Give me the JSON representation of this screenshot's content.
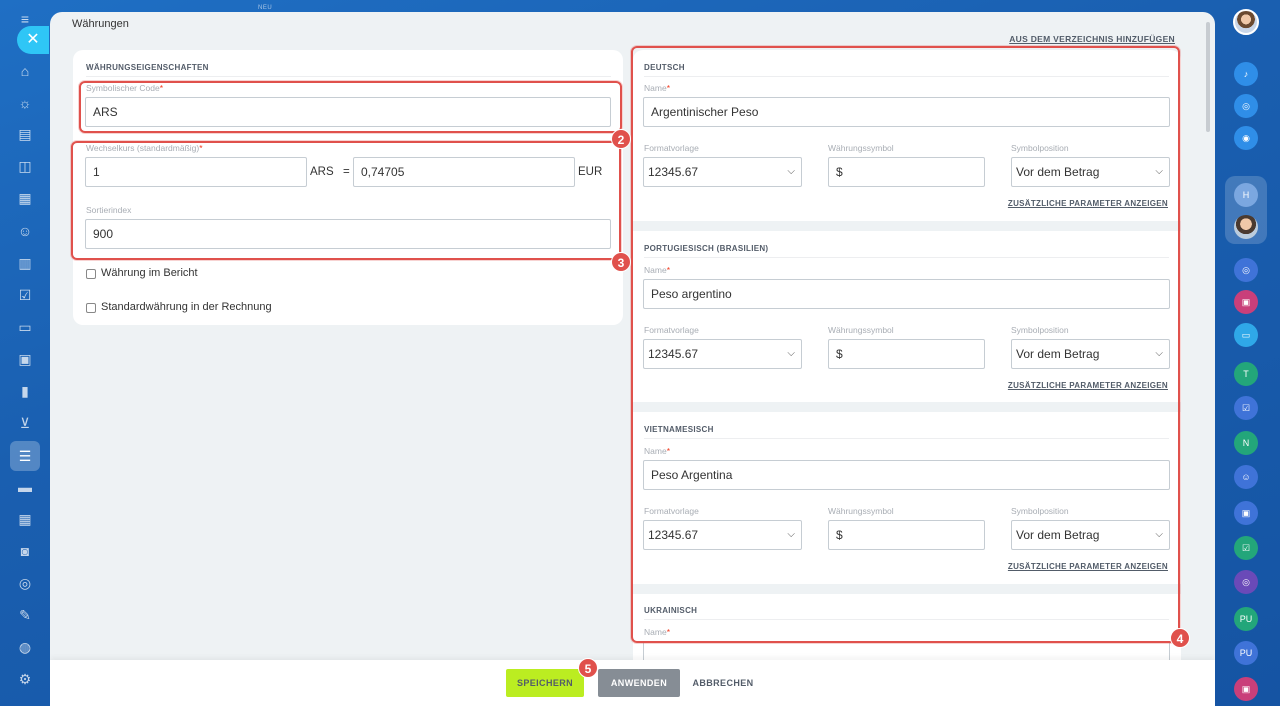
{
  "sidebar": {
    "new_tag": "NEU"
  },
  "page": {
    "title": "Währungen",
    "add_from_directory": "AUS DEM VERZEICHNIS HINZUFÜGEN"
  },
  "properties": {
    "section_title": "WÄHRUNGSEIGENSCHAFTEN",
    "symbolic_code_label": "Symbolischer Code",
    "symbolic_code_value": "ARS",
    "exchange_rate_label": "Wechselkurs (standardmäßig)",
    "rate_amount": "1",
    "rate_currency": "ARS",
    "equals": "=",
    "rate_value": "0,74705",
    "base_currency": "EUR",
    "sort_label": "Sortierindex",
    "sort_value": "900",
    "report_checkbox": "Währung im Bericht",
    "invoice_checkbox": "Standardwährung in der Rechnung"
  },
  "languages": [
    {
      "title": "DEUTSCH",
      "name_label": "Name",
      "name_value": "Argentinischer Peso",
      "format_label": "Formatvorlage",
      "format_value": "12345.67",
      "symbol_label": "Währungssymbol",
      "symbol_value": "$",
      "position_label": "Symbolposition",
      "position_value": "Vor dem Betrag",
      "more": "ZUSÄTZLICHE PARAMETER ANZEIGEN"
    },
    {
      "title": "PORTUGIESISCH (BRASILIEN)",
      "name_label": "Name",
      "name_value": "Peso argentino",
      "format_label": "Formatvorlage",
      "format_value": "12345.67",
      "symbol_label": "Währungssymbol",
      "symbol_value": "$",
      "position_label": "Symbolposition",
      "position_value": "Vor dem Betrag",
      "more": "ZUSÄTZLICHE PARAMETER ANZEIGEN"
    },
    {
      "title": "VIETNAMESISCH",
      "name_label": "Name",
      "name_value": "Peso Argentina",
      "format_label": "Formatvorlage",
      "format_value": "12345.67",
      "symbol_label": "Währungssymbol",
      "symbol_value": "$",
      "position_label": "Symbolposition",
      "position_value": "Vor dem Betrag",
      "more": "ZUSÄTZLICHE PARAMETER ANZEIGEN"
    },
    {
      "title": "UKRAINISCH",
      "name_label": "Name"
    }
  ],
  "badges": [
    "2",
    "3",
    "4",
    "5"
  ],
  "footer": {
    "save": "SPEICHERN",
    "apply": "ANWENDEN",
    "cancel": "ABBRECHEN"
  },
  "right_sidebar": {
    "t_initial": "T",
    "n_initial": "N",
    "pu_initial": "PU"
  },
  "colors": {
    "accent_highlight": "#e0514c",
    "save_button": "#bbed21",
    "background": "#1a5fb0"
  }
}
